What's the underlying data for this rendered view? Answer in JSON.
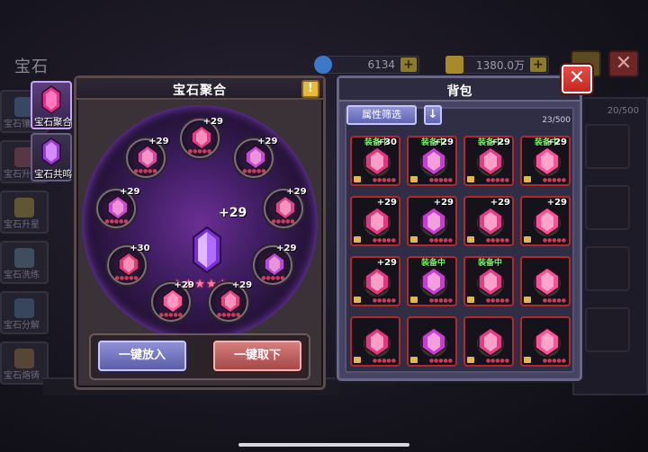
{
  "background": {
    "title": "宝石",
    "diamonds": "6134",
    "gold": "1380.0万",
    "bag_count": "20/500",
    "close_icon": "close-icon",
    "tabs": [
      "宝石镶嵌",
      "宝石升级",
      "宝石升星",
      "宝石洗练",
      "宝石分解",
      "宝石熔铸"
    ]
  },
  "side_tabs": [
    {
      "label": "宝石聚合",
      "icon": "purple-gem-icon"
    },
    {
      "label": "宝石共鸣",
      "icon": "purple-gem-icon"
    }
  ],
  "fuse": {
    "title": "宝石聚合",
    "help_icon": "!",
    "center_value": "+29",
    "center_stars": "★★★★★",
    "sockets": [
      "+29",
      "+29",
      "+29",
      "+29",
      "+29",
      "+29",
      "+30",
      "+29",
      "+29"
    ],
    "btn_put": "一键放入",
    "btn_take": "一键取下"
  },
  "bag": {
    "title": "背包",
    "filter_label": "属性筛选",
    "sort_icon": "↓",
    "capacity": "23/500",
    "equipped_label": "装备中",
    "close_icon": "✕",
    "items": [
      {
        "equipped": true,
        "value": "+30"
      },
      {
        "equipped": true,
        "value": "+29"
      },
      {
        "equipped": true,
        "value": "+29"
      },
      {
        "equipped": true,
        "value": "+29"
      },
      {
        "equipped": false,
        "value": "+29"
      },
      {
        "equipped": false,
        "value": "+29"
      },
      {
        "equipped": false,
        "value": "+29"
      },
      {
        "equipped": false,
        "value": "+29"
      },
      {
        "equipped": false,
        "value": "+29"
      },
      {
        "equipped": true,
        "value": ""
      },
      {
        "equipped": true,
        "value": ""
      },
      {
        "equipped": false,
        "value": ""
      },
      {
        "equipped": false,
        "value": ""
      },
      {
        "equipped": false,
        "value": ""
      },
      {
        "equipped": false,
        "value": ""
      },
      {
        "equipped": false,
        "value": ""
      }
    ]
  },
  "colors": {
    "accent_purple": "#c06bff",
    "gem_pink": "#ff3f8e",
    "close_red": "#d9302a",
    "equipped_green": "#7bf26a"
  }
}
